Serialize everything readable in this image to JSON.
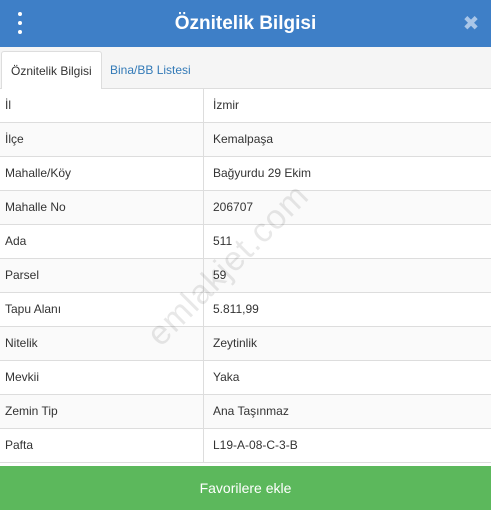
{
  "colors": {
    "header_bg": "#3e7fc7",
    "button_bg": "#5cb85c",
    "link": "#337ab7"
  },
  "header": {
    "title": "Öznitelik Bilgisi",
    "menu_icon": "kebab-menu-icon",
    "close_icon": "close-icon"
  },
  "tabs": [
    {
      "label": "Öznitelik Bilgisi",
      "active": true
    },
    {
      "label": "Bina/BB Listesi",
      "active": false
    }
  ],
  "attributes": [
    {
      "key": "İl",
      "value": "İzmir"
    },
    {
      "key": "İlçe",
      "value": "Kemalpaşa"
    },
    {
      "key": "Mahalle/Köy",
      "value": "Bağyurdu 29 Ekim"
    },
    {
      "key": "Mahalle No",
      "value": "206707"
    },
    {
      "key": "Ada",
      "value": "511"
    },
    {
      "key": "Parsel",
      "value": "59"
    },
    {
      "key": "Tapu Alanı",
      "value": "5.811,99"
    },
    {
      "key": "Nitelik",
      "value": "Zeytinlik"
    },
    {
      "key": "Mevkii",
      "value": "Yaka"
    },
    {
      "key": "Zemin Tip",
      "value": "Ana Taşınmaz"
    },
    {
      "key": "Pafta",
      "value": "L19-A-08-C-3-B"
    }
  ],
  "watermark": "emlakjet.com",
  "footer": {
    "favorite_label": "Favorilere ekle"
  }
}
